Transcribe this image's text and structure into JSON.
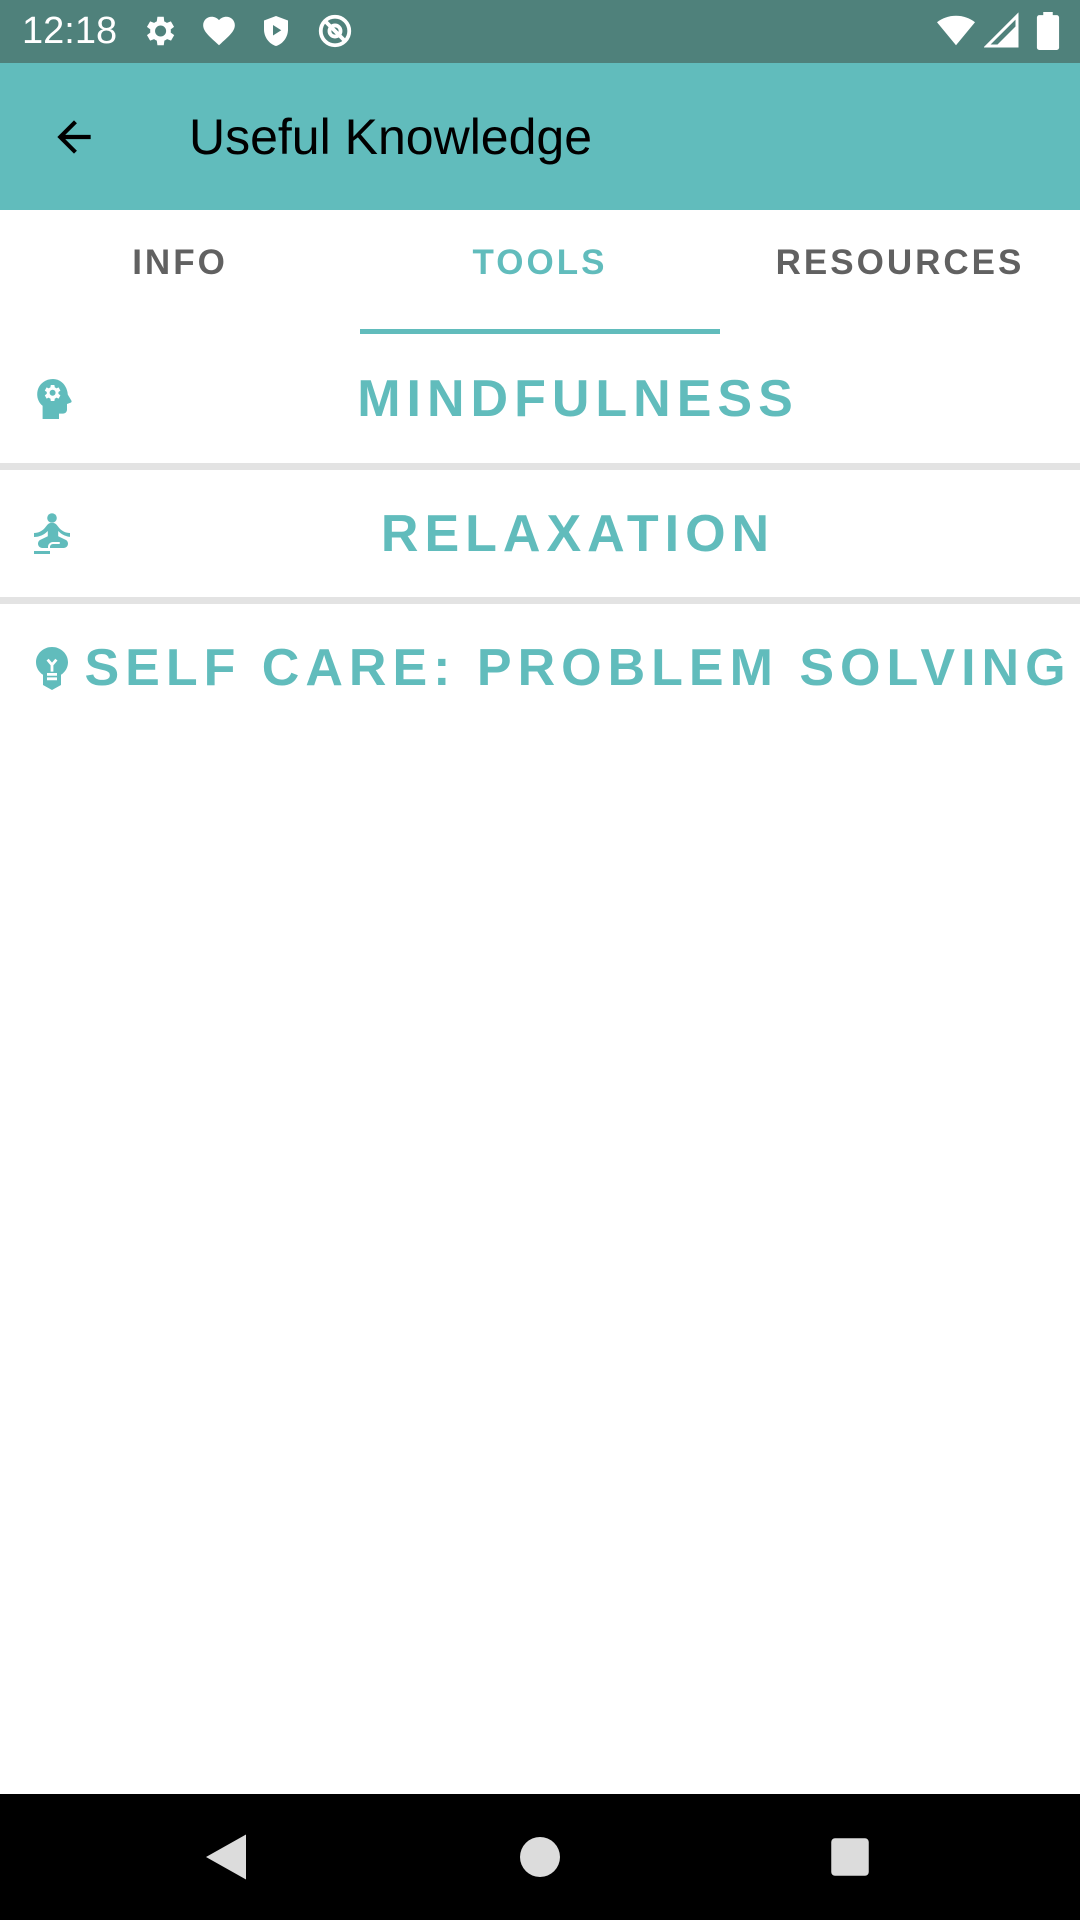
{
  "status_bar": {
    "time": "12:18",
    "left_icons": [
      "gear-icon",
      "heart-icon",
      "shield-play-icon",
      "at-sign-icon"
    ],
    "right_icons": [
      "wifi-icon",
      "signal-icon",
      "battery-icon"
    ]
  },
  "app_bar": {
    "title": "Useful Knowledge",
    "back_icon": "arrow-back-icon",
    "color": "#61bcbc"
  },
  "tabs": [
    {
      "label": "INFO",
      "active": false
    },
    {
      "label": "TOOLS",
      "active": true
    },
    {
      "label": "RESOURCES",
      "active": false
    }
  ],
  "tools": [
    {
      "label": "MINDFULNESS",
      "icon": "head-gear-icon"
    },
    {
      "label": "RELAXATION",
      "icon": "meditation-icon"
    },
    {
      "label": "SELF CARE: PROBLEM SOLVING",
      "icon": "lightbulb-icon"
    }
  ],
  "colors": {
    "accent": "#61bcbc",
    "status_bar": "#4f817b",
    "tab_inactive": "#616161",
    "divider": "#e3e3e3"
  },
  "nav_bar": {
    "buttons": [
      "back-triangle-icon",
      "home-circle-icon",
      "recents-square-icon"
    ]
  }
}
